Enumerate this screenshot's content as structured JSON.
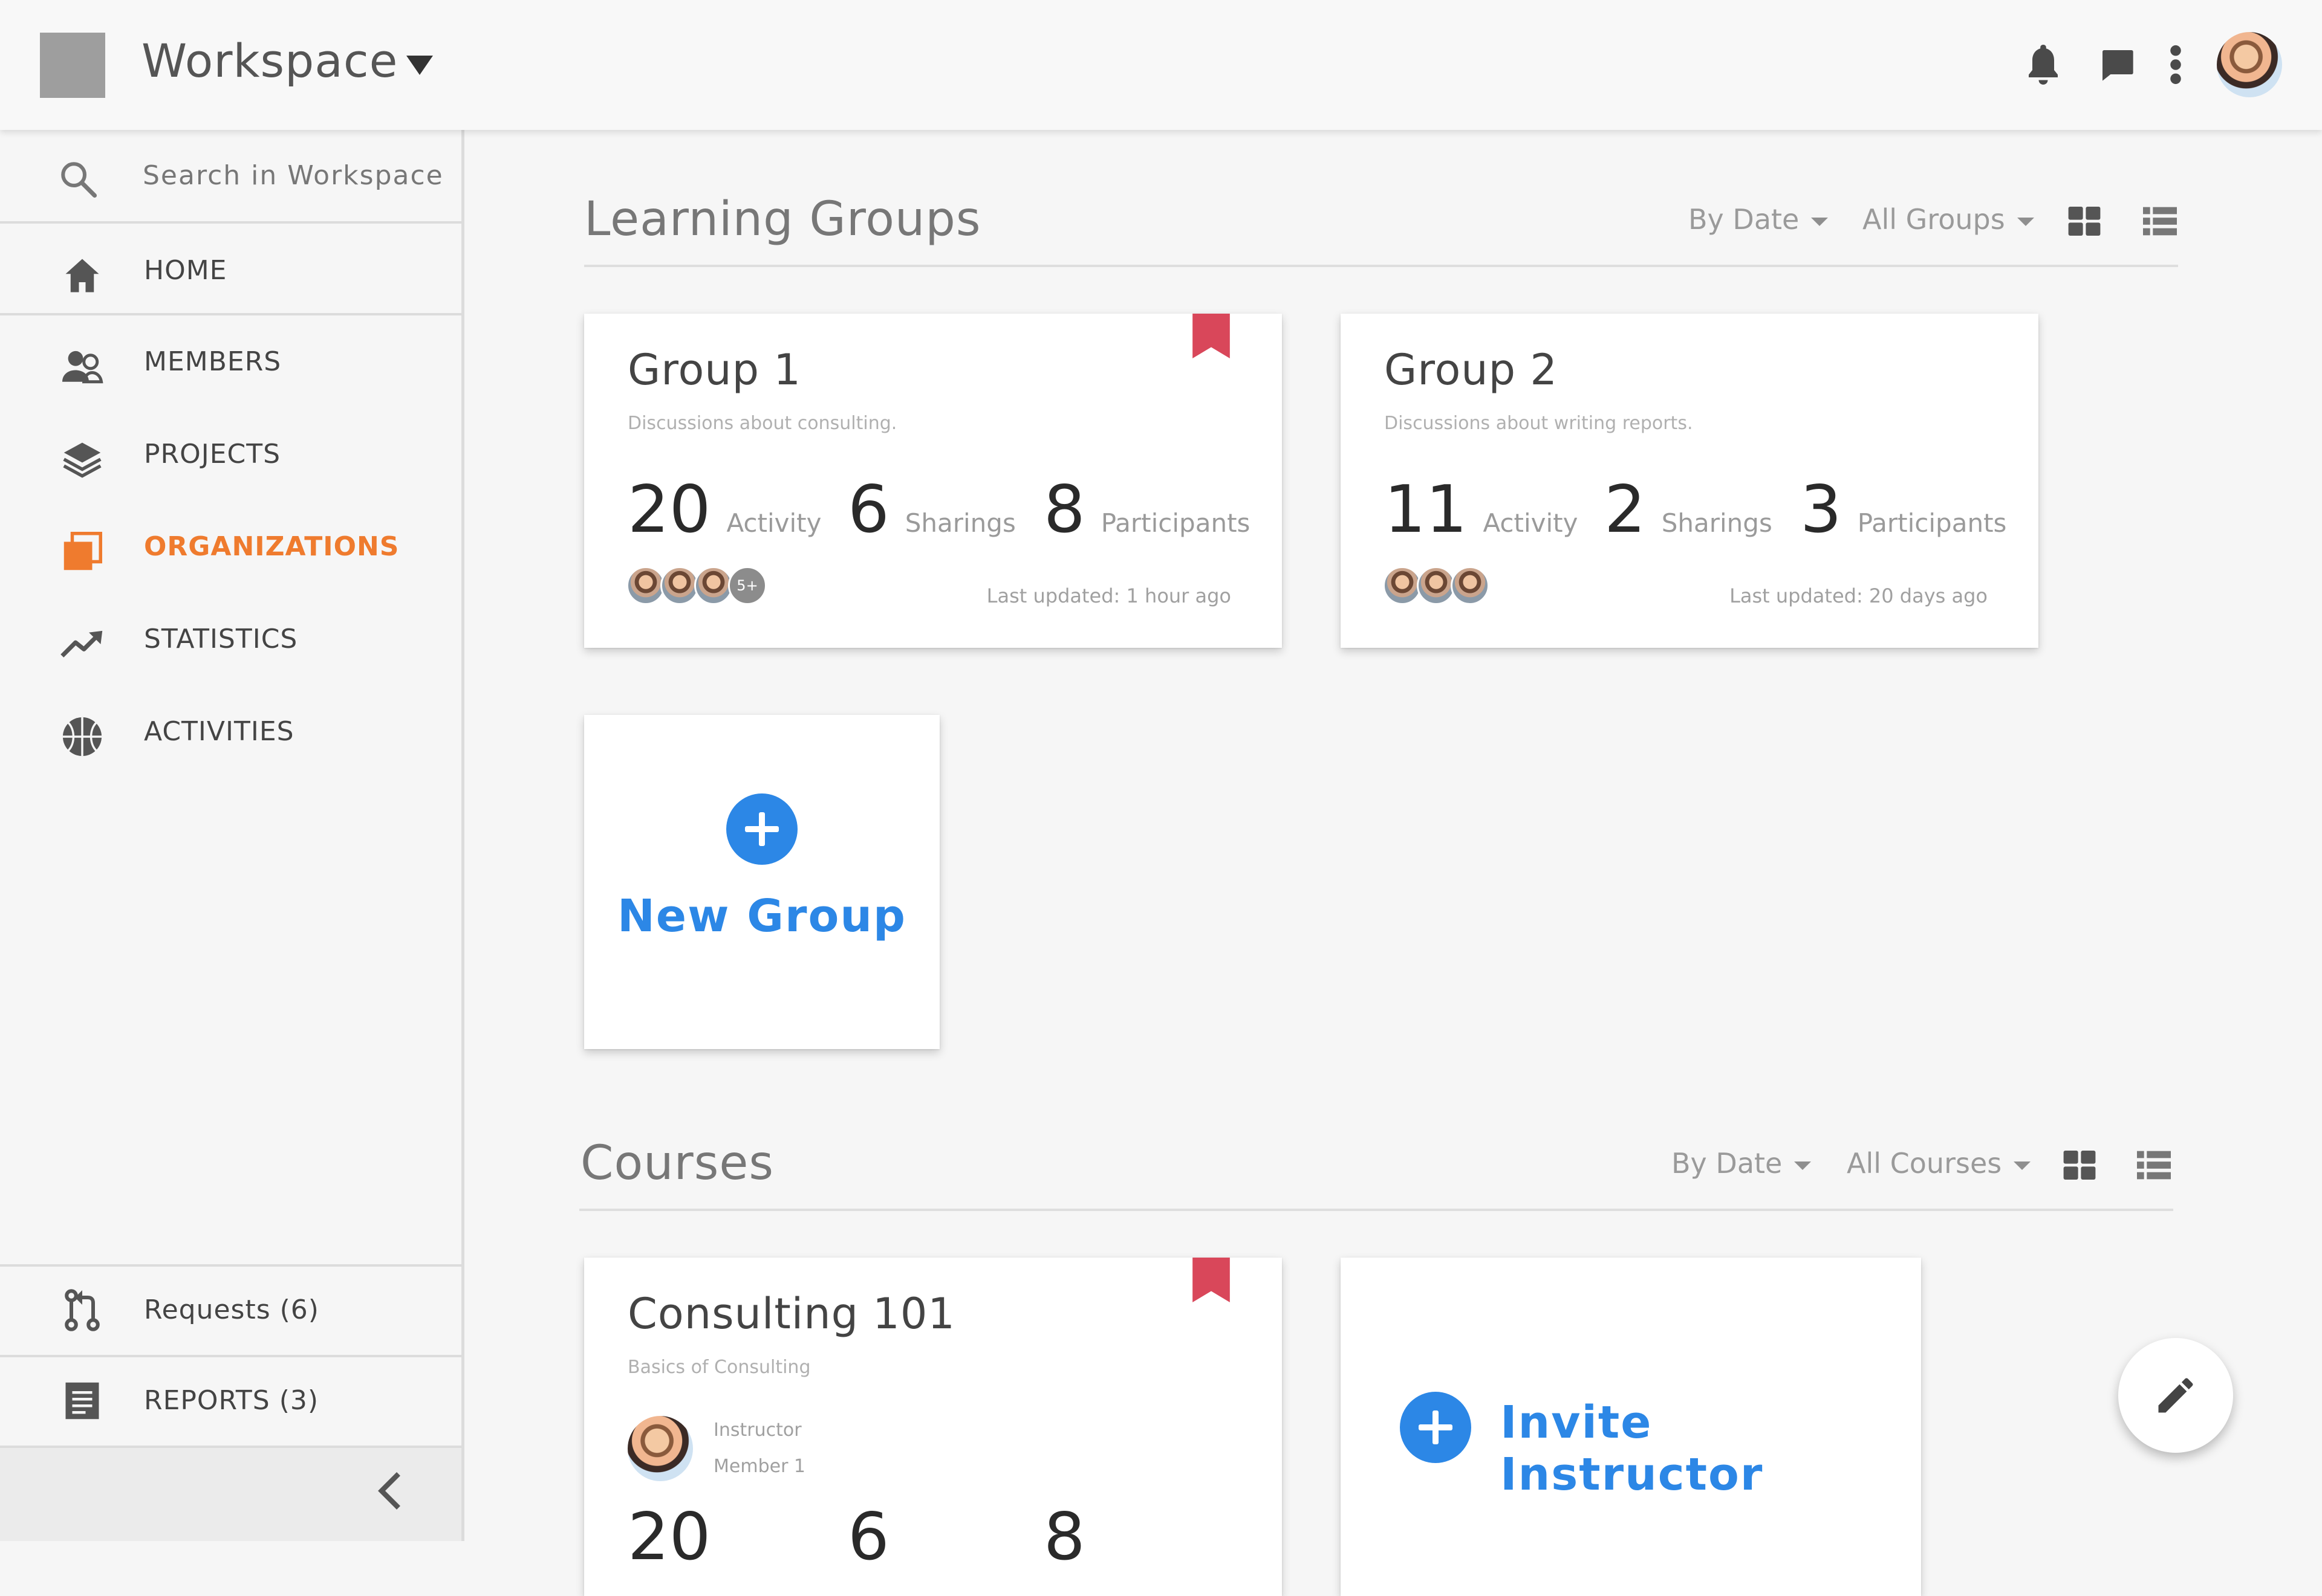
{
  "header": {
    "workspace_title": "Workspace"
  },
  "sidebar": {
    "search_placeholder": "Search in Workspace",
    "items": [
      {
        "label": "HOME",
        "icon": "home-icon"
      },
      {
        "label": "MEMBERS",
        "icon": "members-icon"
      },
      {
        "label": "PROJECTS",
        "icon": "layers-icon"
      },
      {
        "label": "ORGANIZATIONS",
        "icon": "organizations-icon",
        "active": true
      },
      {
        "label": "STATISTICS",
        "icon": "trending-up-icon"
      },
      {
        "label": "ACTIVITIES",
        "icon": "basketball-icon"
      }
    ],
    "requests_label": "Requests (6)",
    "reports_label": "REPORTS (3)"
  },
  "learning_groups": {
    "title": "Learning Groups",
    "sort_label": "By Date",
    "filter_label": "All Groups",
    "groups": [
      {
        "name": "Group 1",
        "description": "Discussions about consulting.",
        "activity": "20",
        "activity_label": "Activity",
        "sharings": "6",
        "sharings_label": "Sharings",
        "participants": "8",
        "participants_label": "Participants",
        "more_badge": "5+",
        "updated": "Last updated: 1 hour ago",
        "bookmarked": true
      },
      {
        "name": "Group 2",
        "description": "Discussions about writing reports.",
        "activity": "11",
        "activity_label": "Activity",
        "sharings": "2",
        "sharings_label": "Sharings",
        "participants": "3",
        "participants_label": "Participants",
        "updated": "Last updated: 20 days ago",
        "bookmarked": false
      }
    ],
    "new_group_label": "New Group"
  },
  "courses": {
    "title": "Courses",
    "sort_label": "By Date",
    "filter_label": "All Courses",
    "course": {
      "name": "Consulting 101",
      "description": "Basics of Consulting",
      "instructor_role": "Instructor",
      "instructor_name": "Member 1",
      "activity": "20",
      "sharings": "6",
      "participants": "8"
    },
    "invite_label": "Invite Instructor"
  },
  "colors": {
    "accent_orange": "#ef7b2e",
    "primary_blue": "#2c87e6",
    "bookmark_red": "#d9475a"
  }
}
